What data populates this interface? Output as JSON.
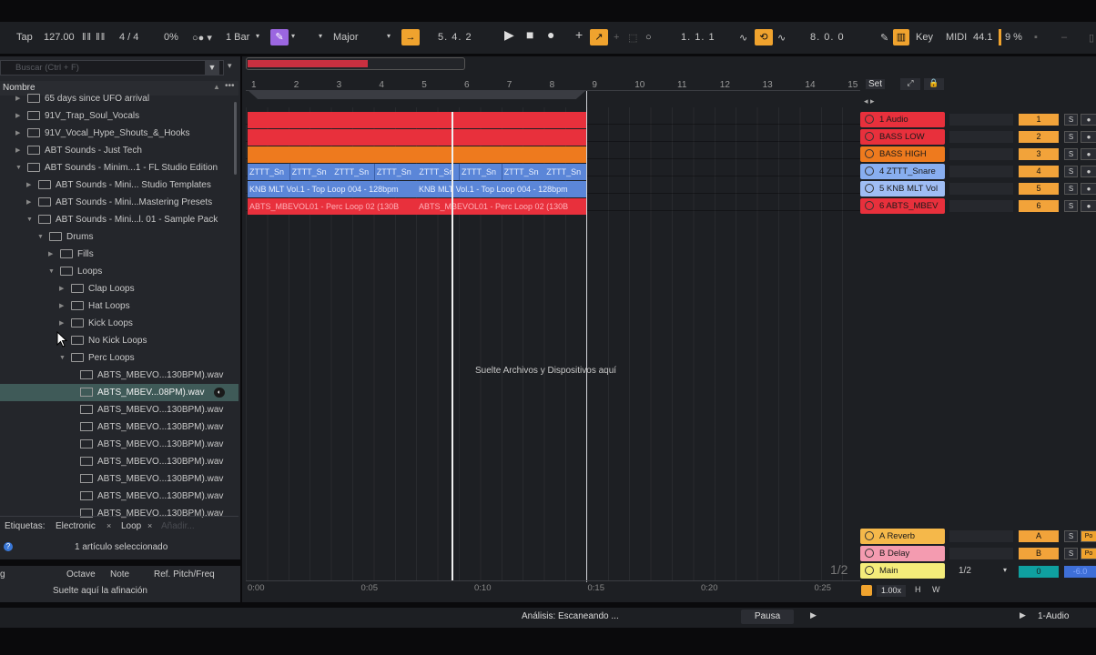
{
  "transport": {
    "tap": "Tap",
    "tempo": "127.00",
    "signature": "4 / 4",
    "swing": "0%",
    "quant": "1 Bar",
    "scale": "Major",
    "position": "5.   4.   2",
    "loop_start": "1.   1.   1",
    "loop_len": "8.   0.   0",
    "key": "Key",
    "midi": "MIDI",
    "sample_rate": "44.1",
    "cpu": "9 %"
  },
  "browser": {
    "search_placeholder": "Buscar (Ctrl + F)",
    "column_header": "Nombre",
    "items": [
      {
        "label": "65 days since UFO arrival",
        "kind": "folder"
      },
      {
        "label": "91V_Trap_Soul_Vocals",
        "kind": "folder"
      },
      {
        "label": "91V_Vocal_Hype_Shouts_&_Hooks",
        "kind": "folder"
      },
      {
        "label": "ABT Sounds - Just Tech",
        "kind": "folder"
      },
      {
        "label": "ABT Sounds - Minim...1 - FL Studio Edition",
        "kind": "folder"
      },
      {
        "label": "ABT Sounds - Mini... Studio Templates",
        "kind": "folder"
      },
      {
        "label": "ABT Sounds - Mini...Mastering Presets",
        "kind": "folder"
      },
      {
        "label": "ABT Sounds - Mini...l. 01 - Sample Pack",
        "kind": "folder"
      },
      {
        "label": "Drums",
        "kind": "folder"
      },
      {
        "label": "Fills",
        "kind": "folder"
      },
      {
        "label": "Loops",
        "kind": "folder"
      },
      {
        "label": "Clap Loops",
        "kind": "folder"
      },
      {
        "label": "Hat Loops",
        "kind": "folder"
      },
      {
        "label": "Kick Loops",
        "kind": "folder"
      },
      {
        "label": "No Kick Loops",
        "kind": "folder"
      },
      {
        "label": "Perc Loops",
        "kind": "folder"
      },
      {
        "label": "ABTS_MBEVO...130BPM).wav",
        "kind": "file"
      },
      {
        "label": "ABTS_MBEV...08PM).wav",
        "kind": "file"
      },
      {
        "label": "ABTS_MBEVO...130BPM).wav",
        "kind": "file"
      },
      {
        "label": "ABTS_MBEVO...130BPM).wav",
        "kind": "file"
      },
      {
        "label": "ABTS_MBEVO...130BPM).wav",
        "kind": "file"
      },
      {
        "label": "ABTS_MBEVO...130BPM).wav",
        "kind": "file"
      },
      {
        "label": "ABTS_MBEVO...130BPM).wav",
        "kind": "file"
      },
      {
        "label": "ABTS_MBEVO...130BPM).wav",
        "kind": "file"
      },
      {
        "label": "ABTS_MBEVO...130BPM).wav",
        "kind": "file"
      }
    ],
    "tags_label": "Etiquetas:",
    "tags": [
      "Electronic",
      "Loop"
    ],
    "tags_add": "Añadir...",
    "selection_status": "1 artículo seleccionado",
    "tuning_headers": [
      "Octave",
      "Note",
      "Ref. Pitch/Freq"
    ],
    "tuning_drop": "Suelte aquí la afinación"
  },
  "arrangement": {
    "drop_hint": "Suelte Archivos y Dispositivos aquí",
    "bar_numbers": [
      "1",
      "2",
      "3",
      "4",
      "5",
      "6",
      "7",
      "8",
      "9",
      "10",
      "11",
      "12",
      "13",
      "14",
      "15"
    ],
    "time_labels": [
      "0:00",
      "0:05",
      "0:10",
      "0:15",
      "0:20",
      "0:25"
    ],
    "clips": {
      "snare": [
        "ZTTT_Sn",
        "ZTTT_Sn",
        "ZTTT_Sn",
        "ZTTT_Sn",
        "ZTTT_Sn",
        "ZTTT_Sn",
        "ZTTT_Sn",
        "ZTTT_Sn"
      ],
      "toploop": [
        "KNB MLT Vol.1 - Top Loop 004 - 128bpm",
        "KNB MLT Vol.1 - Top Loop 004 - 128bpm"
      ],
      "perc": [
        "ABTS_MBEVOL01 - Perc Loop 02 (130B",
        "ABTS_MBEVOL01 - Perc Loop 02 (130B"
      ]
    },
    "zoom": "1/2"
  },
  "tracks": [
    {
      "name": "1 Audio",
      "num": "1",
      "color": "#e8303c"
    },
    {
      "name": "BASS LOW",
      "num": "2",
      "color": "#e8303c"
    },
    {
      "name": "BASS HIGH",
      "num": "3",
      "color": "#ee7a1e"
    },
    {
      "name": "4 ZTTT_Snare",
      "num": "4",
      "color": "#88aef0"
    },
    {
      "name": "5 KNB MLT Vol",
      "num": "5",
      "color": "#9fbdf4"
    },
    {
      "name": "6 ABTS_MBEV",
      "num": "6",
      "color": "#e8303c"
    }
  ],
  "returns": [
    {
      "name": "A Reverb",
      "num": "A",
      "color": "#f5b84a"
    },
    {
      "name": "B Delay",
      "num": "B",
      "color": "#f49bb0"
    }
  ],
  "main": {
    "name": "Main",
    "num": "0",
    "routing": "1/2",
    "color": "#f4ec7a"
  },
  "set_label": "Set",
  "mixer_solo": "S",
  "post": "Po",
  "master_vol": "-6.0",
  "speed": "1.00x",
  "hw": [
    "H",
    "W"
  ],
  "status": {
    "analysis": "Análisis: Escaneando ...",
    "pause": "Pausa",
    "track_label": "1-Audio"
  }
}
